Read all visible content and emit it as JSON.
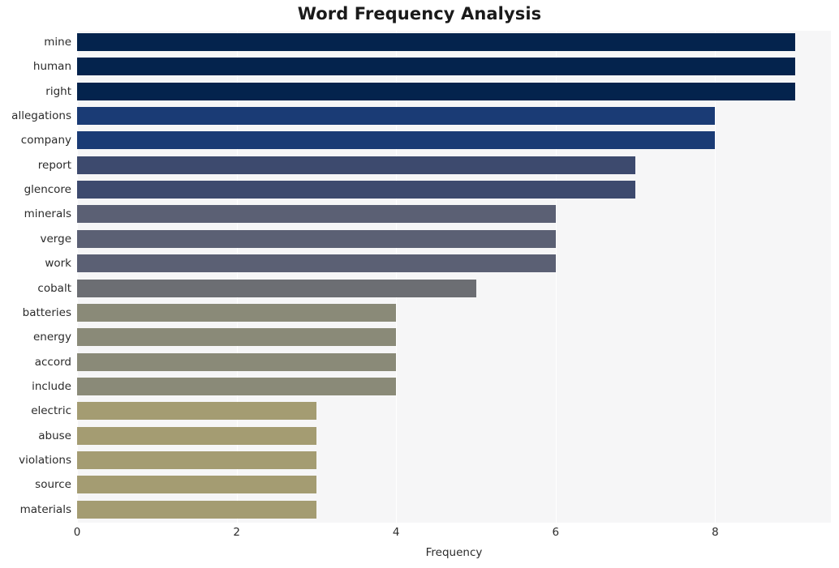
{
  "chart_data": {
    "type": "bar",
    "orientation": "horizontal",
    "title": "Word Frequency Analysis",
    "xlabel": "Frequency",
    "ylabel": "",
    "xlim": [
      0,
      9.45
    ],
    "ylim": [
      0,
      20
    ],
    "grid": true,
    "legend": null,
    "xticks": [
      0,
      2,
      4,
      6,
      8
    ],
    "xtick_labels": [
      "0",
      "2",
      "4",
      "6",
      "8"
    ],
    "categories": [
      "mine",
      "human",
      "right",
      "allegations",
      "company",
      "report",
      "glencore",
      "minerals",
      "verge",
      "work",
      "cobalt",
      "batteries",
      "energy",
      "accord",
      "include",
      "electric",
      "abuse",
      "violations",
      "source",
      "materials"
    ],
    "values": [
      9,
      9,
      9,
      8,
      8,
      7,
      7,
      6,
      6,
      6,
      5,
      4,
      4,
      4,
      4,
      3,
      3,
      3,
      3,
      3
    ],
    "bar_colors": [
      "#04234d",
      "#04234d",
      "#04234d",
      "#1a3b75",
      "#1a3b75",
      "#3d4a6e",
      "#3d4a6e",
      "#5b6074",
      "#5b6074",
      "#5b6074",
      "#6c6e73",
      "#8a8a78",
      "#8a8a78",
      "#8a8a78",
      "#8a8a78",
      "#a49c72",
      "#a49c72",
      "#a49c72",
      "#a49c72",
      "#a49c72"
    ],
    "plot_background": "#f6f6f7",
    "figure_background": "#ffffff",
    "gridline_color": "#ffffff"
  }
}
